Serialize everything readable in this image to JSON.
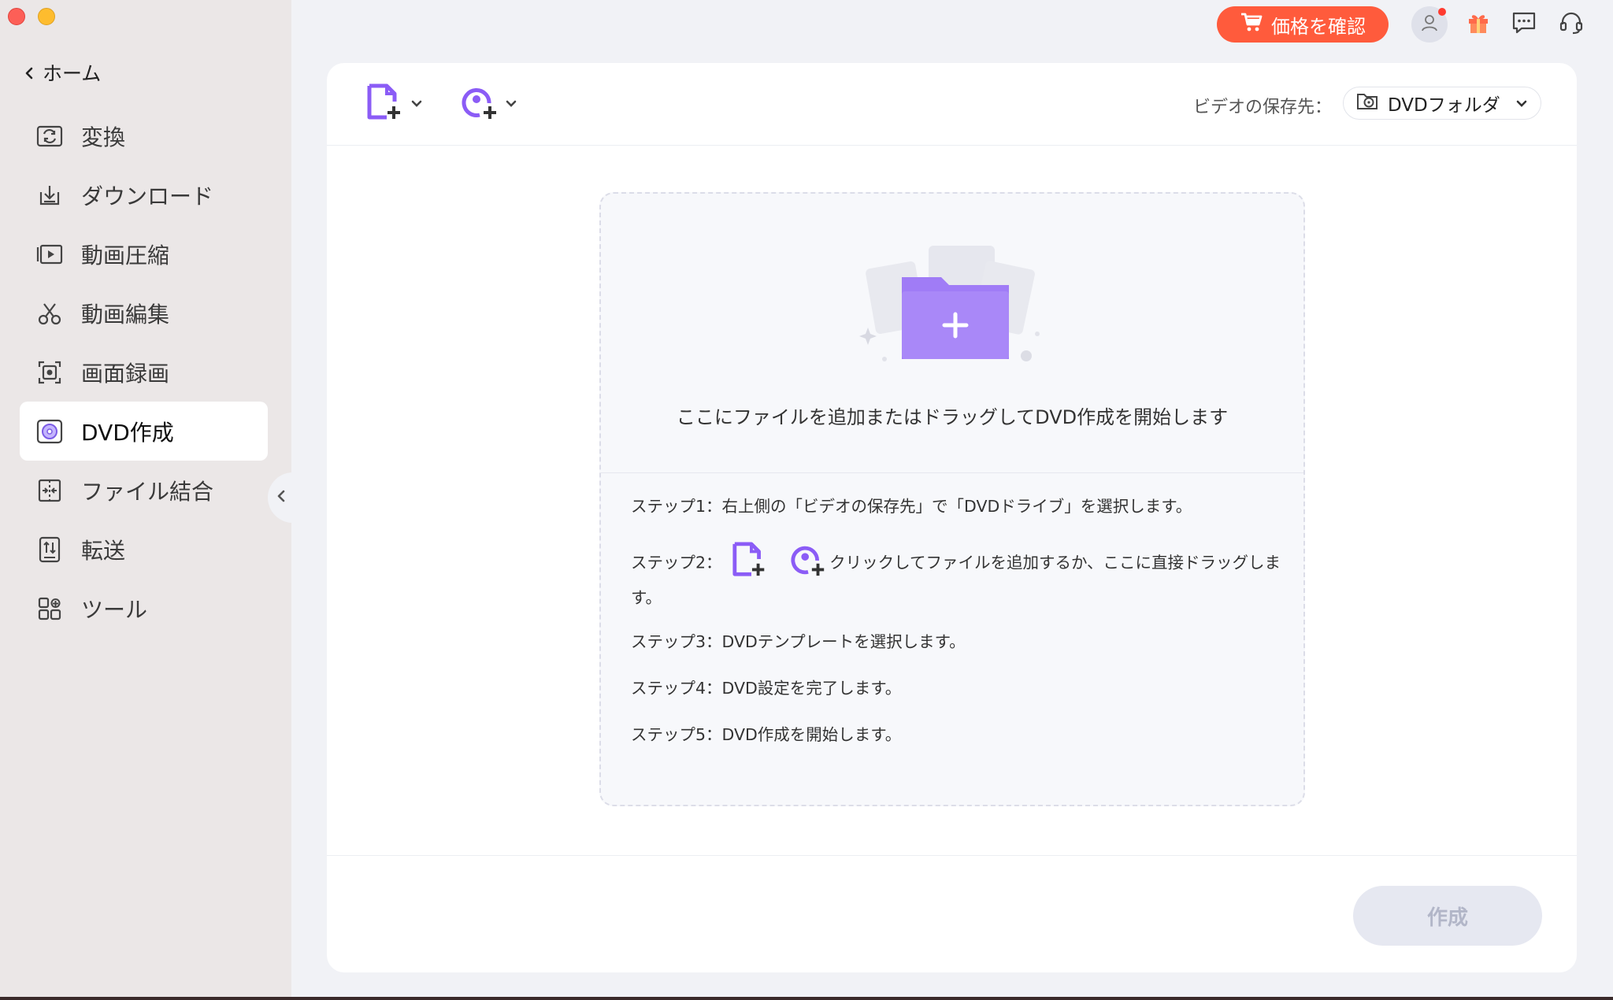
{
  "sidebar": {
    "home_label": "ホーム",
    "items": [
      {
        "label": "変換",
        "icon": "convert-icon"
      },
      {
        "label": "ダウンロード",
        "icon": "download-icon"
      },
      {
        "label": "動画圧縮",
        "icon": "compress-icon"
      },
      {
        "label": "動画編集",
        "icon": "scissors-icon"
      },
      {
        "label": "画面録画",
        "icon": "screen-record-icon"
      },
      {
        "label": "DVD作成",
        "icon": "dvd-icon",
        "active": true
      },
      {
        "label": "ファイル結合",
        "icon": "merge-icon"
      },
      {
        "label": "転送",
        "icon": "transfer-icon"
      },
      {
        "label": "ツール",
        "icon": "tools-icon"
      }
    ]
  },
  "topbar": {
    "price_label": "価格を確認",
    "accent": "#ff5b3c"
  },
  "toolbar": {
    "save_to_label": "ビデオの保存先：",
    "save_to_value": "DVDフォルダ"
  },
  "dropzone": {
    "main_text": "ここにファイルを追加またはドラッグしてDVD作成を開始します",
    "step1": "ステップ1：右上側の「ビデオの保存先」で「DVDドライブ」を選択します。",
    "step2_prefix": "ステップ2：",
    "step2_suffix": "クリックしてファイルを追加するか、ここに直接ドラッグします。",
    "step3": "ステップ3：DVDテンプレートを選択します。",
    "step4": "ステップ4：DVD設定を完了します。",
    "step5": "ステップ5：DVD作成を開始します。"
  },
  "footer": {
    "create_label": "作成"
  },
  "colors": {
    "brand_purple": "#8b5cf6",
    "sidebar_bg": "#ebe7e7"
  }
}
